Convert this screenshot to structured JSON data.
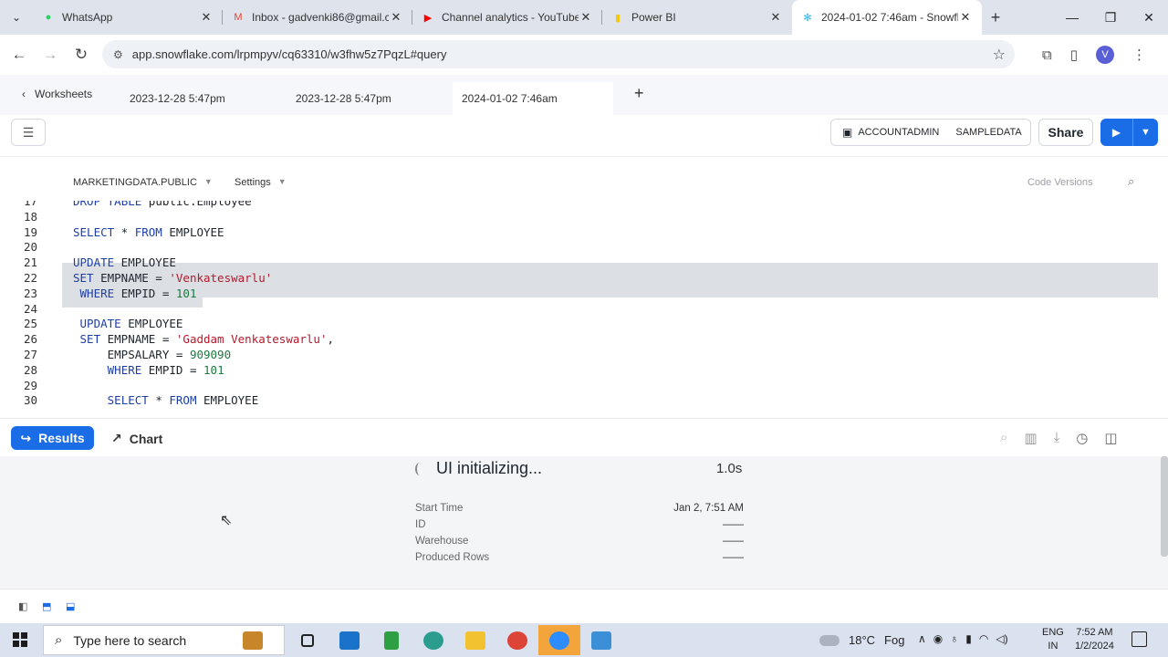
{
  "browser": {
    "tabs": [
      {
        "title": "WhatsApp",
        "icon": "whatsapp-icon",
        "color": "#25d366"
      },
      {
        "title": "Inbox - gadvenki86@gmail.c",
        "icon": "gmail-icon",
        "color": "#ea4335"
      },
      {
        "title": "Channel analytics - YouTube",
        "icon": "youtube-icon",
        "color": "#ff0000"
      },
      {
        "title": "Power BI",
        "icon": "powerbi-icon",
        "color": "#f2c811"
      },
      {
        "title": "2024-01-02 7:46am - Snowfl",
        "icon": "snowflake-icon",
        "color": "#29b5e8",
        "active": true
      }
    ],
    "url": "app.snowflake.com/lrpmpyv/cq63310/w3fhw5z7PqzL#query",
    "avatar_letter": "V"
  },
  "worksheets": {
    "back_label": "Worksheets",
    "tabs": [
      "2023-12-28 5:47pm",
      "2023-12-28 5:47pm",
      "2024-01-02 7:46am"
    ]
  },
  "toolbar": {
    "role": "ACCOUNTADMIN",
    "warehouse": "SAMPLEDATA",
    "share_label": "Share"
  },
  "context": {
    "database": "MARKETINGDATA.PUBLIC",
    "settings": "Settings",
    "code_versions": "Code Versions"
  },
  "editor": {
    "lines": [
      {
        "n": "17",
        "code": "DROP TABLE public.Employee"
      },
      {
        "n": "18",
        "code": ""
      },
      {
        "n": "19",
        "code": "SELECT * FROM EMPLOYEE"
      },
      {
        "n": "20",
        "code": ""
      },
      {
        "n": "21",
        "code": "UPDATE EMPLOYEE"
      },
      {
        "n": "22",
        "code": "SET EMPNAME = 'Venkateswarlu'"
      },
      {
        "n": "23",
        "code": " WHERE EMPID = 101"
      },
      {
        "n": "24",
        "code": ""
      },
      {
        "n": "25",
        "code": " UPDATE EMPLOYEE"
      },
      {
        "n": "26",
        "code": " SET EMPNAME = 'Gaddam Venkateswarlu',"
      },
      {
        "n": "27",
        "code": "     EMPSALARY = 909090"
      },
      {
        "n": "28",
        "code": "     WHERE EMPID = 101"
      },
      {
        "n": "29",
        "code": ""
      },
      {
        "n": "30",
        "code": "     SELECT * FROM EMPLOYEE"
      }
    ]
  },
  "results": {
    "results_label": "Results",
    "chart_label": "Chart",
    "status": "UI initializing...",
    "duration": "1.0s",
    "meta": [
      {
        "label": "Start Time",
        "value": "Jan 2, 7:51 AM"
      },
      {
        "label": "ID",
        "value": "——"
      },
      {
        "label": "Warehouse",
        "value": "——"
      },
      {
        "label": "Produced Rows",
        "value": "——"
      }
    ]
  },
  "taskbar": {
    "search_placeholder": "Type here to search",
    "weather_temp": "18°C",
    "weather_desc": "Fog",
    "lang_line1": "ENG",
    "lang_line2": "IN",
    "time": "7:52 AM",
    "date": "1/2/2024"
  }
}
